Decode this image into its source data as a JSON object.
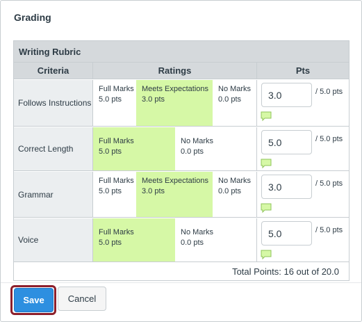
{
  "title": "Grading",
  "rubric": {
    "title": "Writing Rubric",
    "headers": {
      "criteria": "Criteria",
      "ratings": "Ratings",
      "pts": "Pts"
    },
    "rows": [
      {
        "criterion": "Follows Instructions",
        "ratings": [
          {
            "name": "Full Marks",
            "pts": "5.0 pts",
            "selected": false
          },
          {
            "name": "Meets Expectations",
            "pts": "3.0 pts",
            "selected": true
          },
          {
            "name": "No Marks",
            "pts": "0.0 pts",
            "selected": false
          }
        ],
        "score": "3.0",
        "max": "/ 5.0 pts"
      },
      {
        "criterion": "Correct Length",
        "ratings": [
          {
            "name": "Full Marks",
            "pts": "5.0 pts",
            "selected": true
          },
          {
            "name": "No Marks",
            "pts": "0.0 pts",
            "selected": false
          }
        ],
        "score": "5.0",
        "max": "/ 5.0 pts"
      },
      {
        "criterion": "Grammar",
        "ratings": [
          {
            "name": "Full Marks",
            "pts": "5.0 pts",
            "selected": false
          },
          {
            "name": "Meets Expectations",
            "pts": "3.0 pts",
            "selected": true
          },
          {
            "name": "No Marks",
            "pts": "0.0 pts",
            "selected": false
          }
        ],
        "score": "3.0",
        "max": "/ 5.0 pts"
      },
      {
        "criterion": "Voice",
        "ratings": [
          {
            "name": "Full Marks",
            "pts": "5.0 pts",
            "selected": true
          },
          {
            "name": "No Marks",
            "pts": "0.0 pts",
            "selected": false
          }
        ],
        "score": "5.0",
        "max": "/ 5.0 pts"
      }
    ],
    "total": "Total Points: 16 out of 20.0"
  },
  "buttons": {
    "save": "Save",
    "cancel": "Cancel"
  },
  "icons": {
    "comment": "comment-icon"
  },
  "colors": {
    "selected_rating": "#d6f8a6",
    "save_button": "#2d8fe0",
    "focus_ring": "#8c1f2b"
  }
}
